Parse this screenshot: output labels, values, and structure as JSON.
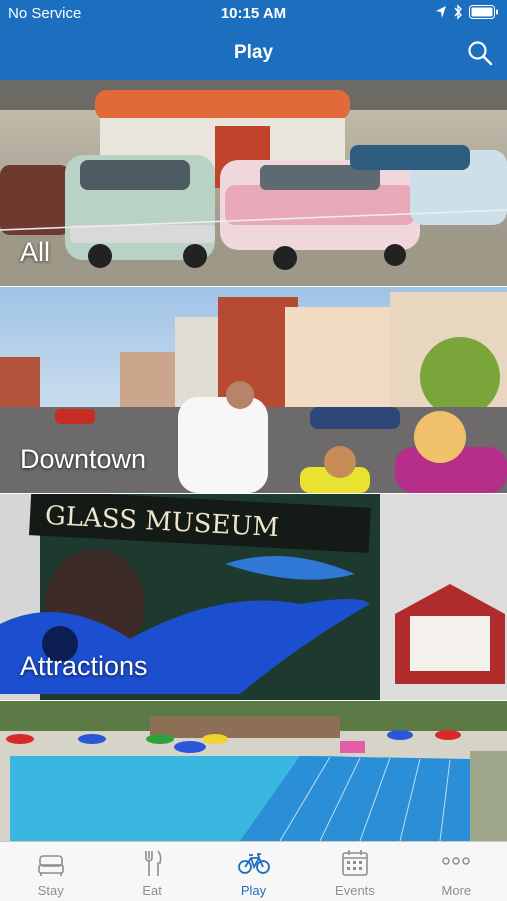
{
  "status_bar": {
    "carrier": "No Service",
    "time": "10:15 AM"
  },
  "nav": {
    "title": "Play",
    "search_icon": "search-icon"
  },
  "tiles": [
    {
      "label": "All",
      "photo": "classic cars in a diner showroom"
    },
    {
      "label": "Downtown",
      "photo": "downtown street with brick buildings"
    },
    {
      "label": "Attractions",
      "photo": "glass museum sign with blue glass fish"
    },
    {
      "label": "",
      "photo": "outdoor public swimming pool"
    }
  ],
  "tabs": [
    {
      "label": "Stay",
      "icon": "bed-icon",
      "active": false
    },
    {
      "label": "Eat",
      "icon": "fork-knife-icon",
      "active": false
    },
    {
      "label": "Play",
      "icon": "bicycle-icon",
      "active": true
    },
    {
      "label": "Events",
      "icon": "calendar-icon",
      "active": false
    },
    {
      "label": "More",
      "icon": "ellipsis-icon",
      "active": false
    }
  ],
  "colors": {
    "brand": "#1b6fbe",
    "tab_inactive": "#8e8e8e"
  }
}
